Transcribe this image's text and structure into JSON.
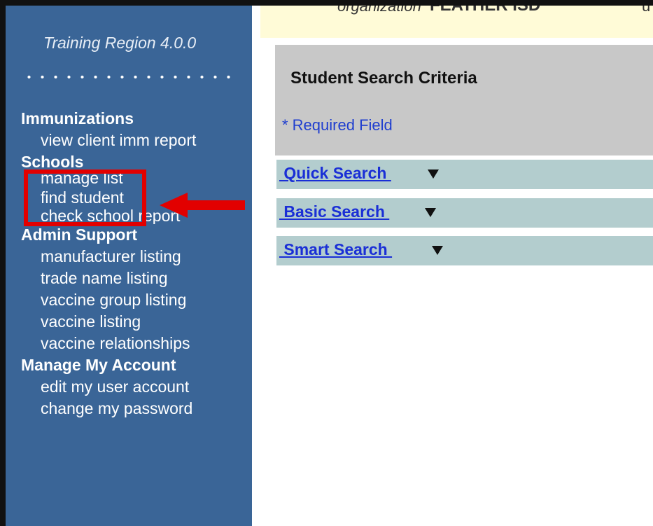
{
  "sidebar": {
    "region_title": "Training Region 4.0.0",
    "sections": [
      {
        "title": "Immunizations",
        "items": [
          "view client imm report"
        ]
      },
      {
        "title": "Schools",
        "items": [
          "manage list",
          "find student",
          "check school report"
        ]
      },
      {
        "title": "Admin Support",
        "items": [
          "manufacturer listing",
          "trade name listing",
          "vaccine group listing",
          "vaccine listing",
          "vaccine relationships"
        ]
      },
      {
        "title": "Manage My Account",
        "items": [
          "edit my user account",
          "change my password"
        ]
      }
    ]
  },
  "header": {
    "organization_label": "organization",
    "organization_value": "FEATHER ISD",
    "tail": "u"
  },
  "criteria": {
    "title": "Student Search Criteria",
    "required_note": "* Required Field"
  },
  "searches": {
    "quick": " Quick Search ",
    "basic": " Basic Search ",
    "smart": " Smart Search "
  },
  "colors": {
    "sidebar": "#3a6597",
    "highlight": "#e20000",
    "link": "#1a2fd6",
    "search_row": "#b3cdce"
  }
}
